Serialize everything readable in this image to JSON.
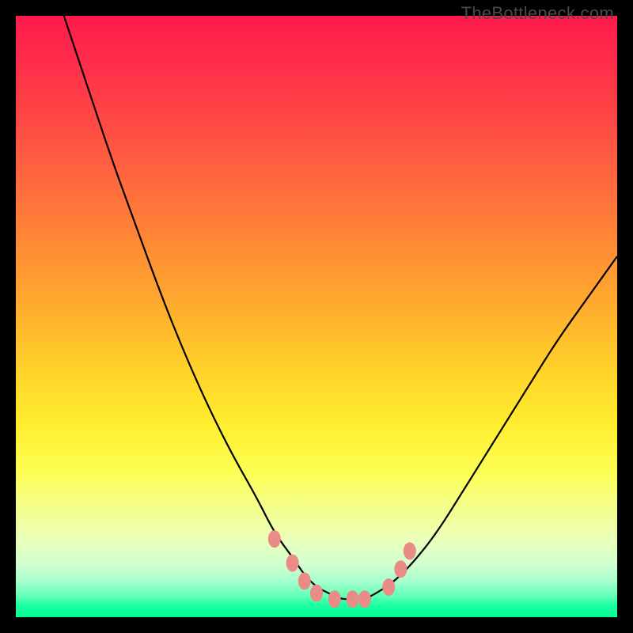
{
  "watermark": "TheBottleneck.com",
  "colors": {
    "frame": "#000000",
    "curve_stroke": "#000000",
    "marker_fill": "#e98b86",
    "marker_stroke": "#7f2d29"
  },
  "chart_data": {
    "type": "line",
    "title": "",
    "xlabel": "",
    "ylabel": "",
    "xlim": [
      0,
      100
    ],
    "ylim": [
      0,
      100
    ],
    "series": [
      {
        "name": "bottleneck-curve",
        "x": [
          8,
          12,
          16,
          20,
          24,
          28,
          32,
          36,
          40,
          43,
          46,
          48,
          50,
          52,
          54,
          56,
          58,
          60,
          63,
          66,
          70,
          75,
          80,
          85,
          90,
          95,
          100
        ],
        "y": [
          100,
          88,
          76,
          65,
          54,
          44,
          35,
          27,
          20,
          14,
          10,
          7,
          5,
          4,
          3,
          3,
          3,
          4,
          6,
          9,
          14,
          22,
          30,
          38,
          46,
          53,
          60
        ]
      }
    ],
    "markers": {
      "name": "highlight-points",
      "x": [
        43,
        46,
        48,
        50,
        53,
        56,
        58,
        62,
        64,
        65.5
      ],
      "y": [
        13,
        9,
        6,
        4,
        3,
        3,
        3,
        5,
        8,
        11
      ]
    }
  }
}
